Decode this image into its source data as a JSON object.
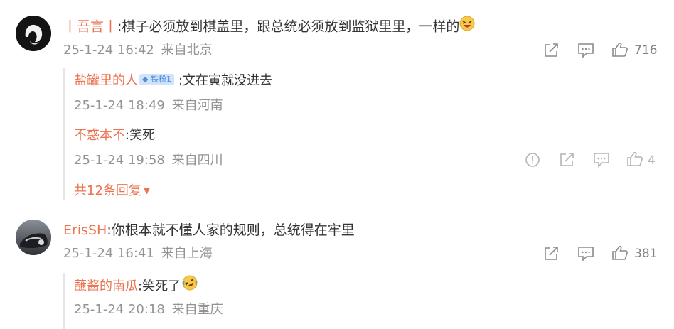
{
  "comments": [
    {
      "username": "丨吾言丨",
      "text": ":棋子必须放到棋盖里，跟总统必须放到监狱里里，一样的",
      "emoji": "laughing-emoji",
      "date": "25-1-24 16:42",
      "location": "来自北京",
      "likes": "716",
      "replies": [
        {
          "username": "盐罐里的人",
          "badge": "铁粉1",
          "text": ":文在寅就没进去",
          "date": "25-1-24 18:49",
          "location": "来自河南"
        },
        {
          "username": "不惑本不",
          "text": ":笑死",
          "date": "25-1-24 19:58",
          "location": "来自四川",
          "likes": "4"
        }
      ],
      "more_replies": "共12条回复"
    },
    {
      "username": "ErisSH",
      "text": ":你根本就不懂人家的规则，总统得在牢里",
      "date": "25-1-24 16:41",
      "location": "来自上海",
      "likes": "381",
      "replies": [
        {
          "username": "蘸酱的南瓜",
          "text": ":笑死了",
          "emoji": "rolling-laugh-emoji",
          "date": "25-1-24 20:18",
          "location": "来自重庆"
        }
      ]
    }
  ],
  "colors": {
    "username": "#eb7350",
    "meta": "#939393",
    "text": "#333333",
    "icon": "#8a8a8a"
  }
}
